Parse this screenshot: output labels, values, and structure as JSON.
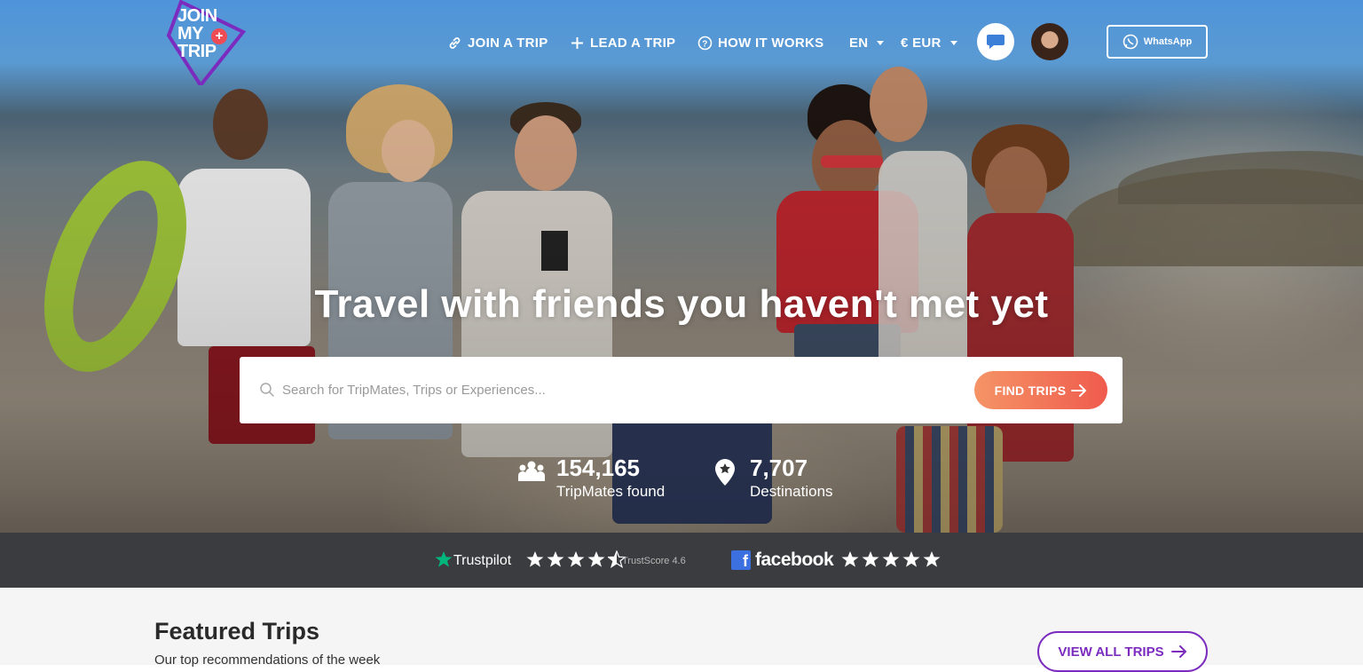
{
  "brand": {
    "logo_line1": "JOIN",
    "logo_line2": "MY",
    "logo_line3": "TRIP",
    "accent_purple": "#7b2cbf",
    "accent_red": "#ef4b55"
  },
  "nav": {
    "join_label": "JOIN A TRIP",
    "lead_label": "LEAD A TRIP",
    "how_label": "HOW IT WORKS",
    "language": "EN",
    "currency": "€ EUR",
    "whatsapp_label": "WhatsApp"
  },
  "hero": {
    "headline": "Travel with friends you haven't met yet",
    "search_placeholder": "Search for TripMates, Trips or Experiences...",
    "find_button": "FIND TRIPS",
    "stats": [
      {
        "value": "154,165",
        "label": "TripMates found",
        "icon": "group-icon"
      },
      {
        "value": "7,707",
        "label": "Destinations",
        "icon": "map-pin-star-icon"
      }
    ]
  },
  "ratings": {
    "trustpilot_name": "Trustpilot",
    "trustpilot_stars": 4.5,
    "trustscore_text": "TrustScore 4.6",
    "facebook_name": "facebook",
    "facebook_stars": 5,
    "trustpilot_color": "#00b67a",
    "facebook_color": "#3c6fe0"
  },
  "featured": {
    "title": "Featured Trips",
    "subtitle": "Our top recommendations of the week",
    "view_all_label": "VIEW ALL TRIPS"
  }
}
